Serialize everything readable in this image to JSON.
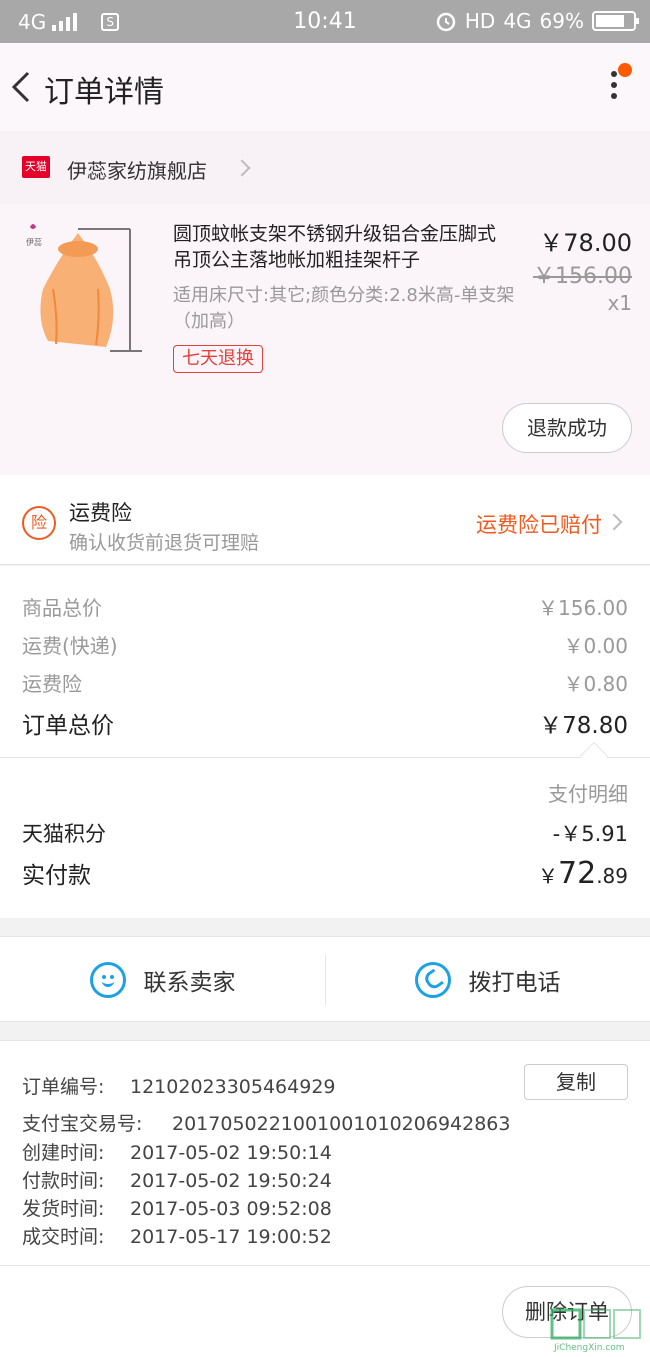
{
  "status_bar": {
    "network": "4G",
    "time": "10:41",
    "hd": "HD",
    "net_right": "4G",
    "battery_pct": "69%"
  },
  "nav": {
    "title": "订单详情"
  },
  "store": {
    "badge": "天猫",
    "name": "伊蕊家纺旗舰店"
  },
  "product": {
    "title": "圆顶蚊帐支架不锈钢升级铝合金压脚式吊顶公主落地帐加粗挂架杆子",
    "spec": "适用床尺寸:其它;颜色分类:2.8米高-单支架（加高）",
    "tag": "七天退换",
    "price": "￥78.00",
    "original_price": "￥156.00",
    "quantity": "x1",
    "refund_status": "退款成功",
    "thumb_brand": "伊蕊"
  },
  "insurance": {
    "icon_text": "险",
    "title": "运费险",
    "subtitle": "确认收货前退货可理赔",
    "status": "运费险已赔付"
  },
  "summary": {
    "rows": [
      {
        "label": "商品总价",
        "value": "￥156.00"
      },
      {
        "label": "运费(快递)",
        "value": "￥0.00"
      },
      {
        "label": "运费险",
        "value": "￥0.80"
      }
    ],
    "total_label": "订单总价",
    "total_value": "￥78.80"
  },
  "payment": {
    "detail_link": "支付明细",
    "points_label": "天猫积分",
    "points_value": "-￥5.91",
    "actual_label": "实付款",
    "actual_currency": "￥",
    "actual_int": "72",
    "actual_dec": ".89"
  },
  "contact": {
    "seller_label": "联系卖家",
    "call_label": "拨打电话"
  },
  "order_info": {
    "copy_label": "复制",
    "lines": [
      {
        "label": "订单编号:",
        "value": "12102023305464929"
      },
      {
        "label": "支付宝交易号:",
        "value": "2017050221001001010206942863"
      },
      {
        "label": "创建时间:",
        "value": "2017-05-02 19:50:14"
      },
      {
        "label": "付款时间:",
        "value": "2017-05-02 19:50:24"
      },
      {
        "label": "发货时间:",
        "value": "2017-05-03 09:52:08"
      },
      {
        "label": "成交时间:",
        "value": "2017-05-17 19:00:52"
      }
    ]
  },
  "footer": {
    "delete_label": "删除订单",
    "watermark_text": "JiChengXin.com"
  },
  "colors": {
    "accent": "#f05a1e",
    "tmall_red": "#e4002b",
    "link_blue": "#1da1e6"
  }
}
